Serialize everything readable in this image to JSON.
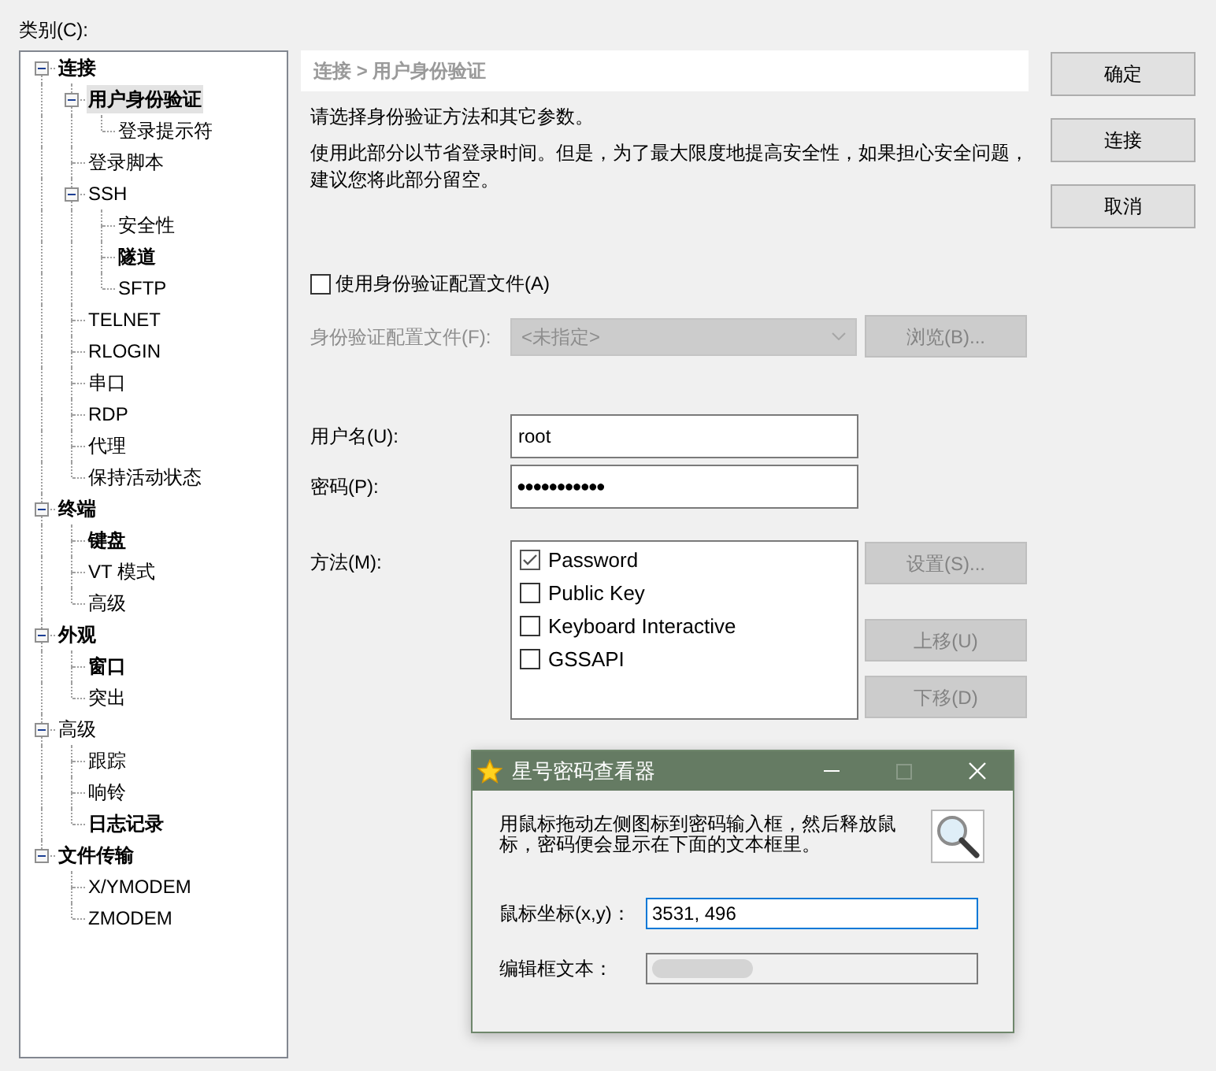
{
  "tree": {
    "label": "类别(C):",
    "items": [
      {
        "label": "连接",
        "bold": true,
        "selected": false,
        "expanded": true,
        "children": [
          {
            "label": "用户身份验证",
            "bold": true,
            "selected": true,
            "expanded": true,
            "children": [
              {
                "label": "登录提示符",
                "bold": false,
                "selected": false
              }
            ]
          },
          {
            "label": "登录脚本",
            "bold": false,
            "selected": false
          },
          {
            "label": "SSH",
            "bold": false,
            "selected": false,
            "expanded": true,
            "children": [
              {
                "label": "安全性",
                "bold": false,
                "selected": false
              },
              {
                "label": "隧道",
                "bold": true,
                "selected": false
              },
              {
                "label": "SFTP",
                "bold": false,
                "selected": false
              }
            ]
          },
          {
            "label": "TELNET",
            "bold": false,
            "selected": false
          },
          {
            "label": "RLOGIN",
            "bold": false,
            "selected": false
          },
          {
            "label": "串口",
            "bold": false,
            "selected": false
          },
          {
            "label": "RDP",
            "bold": false,
            "selected": false
          },
          {
            "label": "代理",
            "bold": false,
            "selected": false
          },
          {
            "label": "保持活动状态",
            "bold": false,
            "selected": false
          }
        ]
      },
      {
        "label": "终端",
        "bold": true,
        "selected": false,
        "expanded": true,
        "children": [
          {
            "label": "键盘",
            "bold": true,
            "selected": false
          },
          {
            "label": "VT 模式",
            "bold": false,
            "selected": false
          },
          {
            "label": "高级",
            "bold": false,
            "selected": false
          }
        ]
      },
      {
        "label": "外观",
        "bold": true,
        "selected": false,
        "expanded": true,
        "children": [
          {
            "label": "窗口",
            "bold": true,
            "selected": false
          },
          {
            "label": "突出",
            "bold": false,
            "selected": false
          }
        ]
      },
      {
        "label": "高级",
        "bold": false,
        "selected": false,
        "expanded": true,
        "children": [
          {
            "label": "跟踪",
            "bold": false,
            "selected": false
          },
          {
            "label": "响铃",
            "bold": false,
            "selected": false
          },
          {
            "label": "日志记录",
            "bold": true,
            "selected": false
          }
        ]
      },
      {
        "label": "文件传输",
        "bold": true,
        "selected": false,
        "expanded": true,
        "children": [
          {
            "label": "X/YMODEM",
            "bold": false,
            "selected": false
          },
          {
            "label": "ZMODEM",
            "bold": false,
            "selected": false
          }
        ]
      }
    ]
  },
  "breadcrumb": "连接 > 用户身份验证",
  "intro": "请选择身份验证方法和其它参数。",
  "description": "使用此部分以节省登录时间。但是，为了最大限度地提高安全性，如果担心安全问题，建议您将此部分留空。",
  "profile": {
    "checkbox": {
      "label": "使用身份验证配置文件(A)",
      "checked": false
    },
    "field": {
      "label": "身份验证配置文件(F):",
      "value": "<未指定>",
      "disabled": true
    },
    "browse_button": {
      "label": "浏览(B)...",
      "disabled": true
    }
  },
  "credentials": {
    "username": {
      "label": "用户名(U):",
      "value": "root"
    },
    "password": {
      "label": "密码(P):",
      "value": "●●●●●●●●●●●"
    }
  },
  "methods": {
    "label": "方法(M):",
    "items": [
      {
        "label": "Password",
        "checked": true
      },
      {
        "label": "Public Key",
        "checked": false
      },
      {
        "label": "Keyboard Interactive",
        "checked": false
      },
      {
        "label": "GSSAPI",
        "checked": false
      }
    ],
    "buttons": [
      {
        "label": "设置(S)...",
        "disabled": true
      },
      {
        "label": "上移(U)",
        "disabled": true
      },
      {
        "label": "下移(D)",
        "disabled": true
      }
    ]
  },
  "dialog_buttons": [
    {
      "label": "确定",
      "disabled": false
    },
    {
      "label": "连接",
      "disabled": false
    },
    {
      "label": "取消",
      "disabled": false
    }
  ],
  "viewer": {
    "title": "星号密码查看器",
    "title_buttons": [
      {
        "kind": "minimize",
        "disabled": false
      },
      {
        "kind": "maximize",
        "disabled": true
      },
      {
        "kind": "close",
        "disabled": false
      }
    ],
    "instructions": "用鼠标拖动左侧图标到密码输入框，然后释放鼠标，密码便会显示在下面的文本框里。",
    "fields": [
      {
        "label": "鼠标坐标(x,y)：",
        "value": "3531, 496",
        "focused": true,
        "readonly": false,
        "obscured": false
      },
      {
        "label": "编辑框文本：",
        "focused": false,
        "readonly": true,
        "obscured": true
      }
    ]
  }
}
